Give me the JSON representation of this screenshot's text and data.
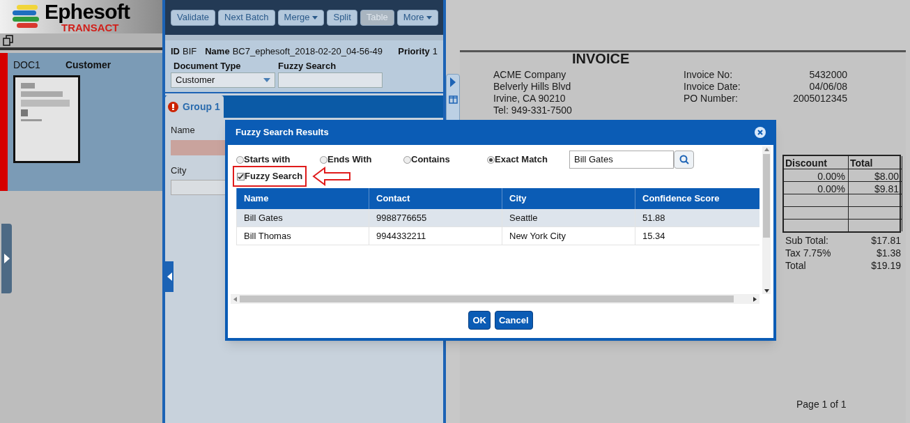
{
  "logo": {
    "name": "Ephesoft",
    "tagline": "TRANSACT"
  },
  "documents": [
    {
      "id": "DOC1",
      "type": "Customer",
      "selected": true
    }
  ],
  "toolbar": [
    {
      "label": "Validate",
      "disabled": false,
      "dropdown": false
    },
    {
      "label": "Next Batch",
      "disabled": false,
      "dropdown": false
    },
    {
      "label": "Merge",
      "disabled": false,
      "dropdown": true
    },
    {
      "label": "Split",
      "disabled": false,
      "dropdown": false
    },
    {
      "label": "Table",
      "disabled": true,
      "dropdown": false
    },
    {
      "label": "More",
      "disabled": false,
      "dropdown": true
    }
  ],
  "batch": {
    "id_label": "ID",
    "id": "BIF",
    "name_label": "Name",
    "name": "BC7_ephesoft_2018-02-20_04-56-49",
    "priority_label": "Priority",
    "priority": "1"
  },
  "document_type": {
    "label": "Document Type",
    "value": "Customer"
  },
  "fuzzy_search_field": {
    "label": "Fuzzy Search"
  },
  "group_tab": {
    "label": "Group 1",
    "error": true
  },
  "fields": [
    {
      "label": "Name",
      "invalid": true
    },
    {
      "label": "City",
      "invalid": false
    }
  ],
  "dialog": {
    "title": "Fuzzy Search Results",
    "options": [
      {
        "label": "Starts with",
        "selected": false
      },
      {
        "label": "Ends With",
        "selected": false
      },
      {
        "label": "Contains",
        "selected": false
      },
      {
        "label": "Exact Match",
        "selected": true
      }
    ],
    "fuzzy": {
      "label": "Fuzzy Search",
      "checked": true
    },
    "search_value": "Bill Gates",
    "columns": [
      "Name",
      "Contact",
      "City",
      "Confidence Score"
    ],
    "rows": [
      {
        "cells": [
          "Bill Gates",
          "9988776655",
          "Seattle",
          "51.88"
        ],
        "selected": true
      },
      {
        "cells": [
          "Bill Thomas",
          "9944332211",
          "New York City",
          "15.34"
        ],
        "selected": false
      }
    ],
    "buttons": [
      "OK",
      "Cancel"
    ]
  },
  "invoice": {
    "title": "INVOICE",
    "address": [
      "ACME Company",
      "Belverly Hills Blvd",
      "Irvine, CA 90210",
      "Tel: 949-331-7500"
    ],
    "meta": [
      {
        "label": "Invoice No:",
        "value": "5432000"
      },
      {
        "label": "Invoice Date:",
        "value": "04/06/08"
      },
      {
        "label": "PO Number:",
        "value": "2005012345"
      }
    ],
    "columns": [
      "Discount",
      "Total"
    ],
    "rows": [
      [
        "0.00%",
        "$8.00"
      ],
      [
        "0.00%",
        "$9.81"
      ]
    ],
    "totals": [
      {
        "label": "Sub Total:",
        "value": "$17.81"
      },
      {
        "label": "Tax 7.75%",
        "value": "$1.38"
      },
      {
        "label": "Total",
        "value": "$19.19"
      }
    ],
    "footer": "Page 1 of 1"
  }
}
